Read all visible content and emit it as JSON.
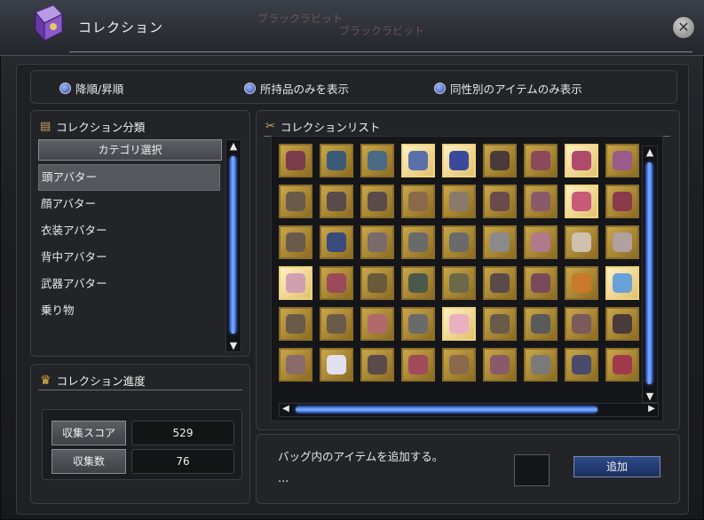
{
  "window": {
    "title": "コレクション",
    "bg_text_1": "ブラックラビット",
    "bg_text_2": "ブラックラビット"
  },
  "options": [
    {
      "label": "降順/昇順"
    },
    {
      "label": "所持品のみを表示"
    },
    {
      "label": "同性別のアイテムのみ表示"
    }
  ],
  "category_panel": {
    "heading": "コレクション分類",
    "select_button": "カテゴリ選択",
    "items": [
      {
        "label": "頭アバター",
        "selected": true
      },
      {
        "label": "顔アバター",
        "selected": false
      },
      {
        "label": "衣装アバター",
        "selected": false
      },
      {
        "label": "背中アバター",
        "selected": false
      },
      {
        "label": "武器アバター",
        "selected": false
      },
      {
        "label": "乗り物",
        "selected": false
      }
    ]
  },
  "progress_panel": {
    "heading": "コレクション進度",
    "score_label": "収集スコア",
    "score_value": "529",
    "count_label": "収集数",
    "count_value": "76"
  },
  "list_panel": {
    "heading": "コレクションリスト",
    "grid": {
      "rows": 6,
      "cols": 9,
      "highlighted": [
        3,
        4,
        7,
        16,
        27,
        35,
        40,
        55
      ],
      "icon_colors": [
        "#7a3b4a",
        "#3a5a78",
        "#4a6a86",
        "#5a70a8",
        "#3a4a9a",
        "#4a3a3a",
        "#8a4a5a",
        "#b04a6a",
        "#9a5a8a",
        "#6a5a4a",
        "#5a4a4a",
        "#5a4a4a",
        "#8a6a4a",
        "#8a7a6a",
        "#6a4a4a",
        "#8a5a6a",
        "#c85a7a",
        "#8a3a4a",
        "#6a5a4a",
        "#3a4a7a",
        "#7a6a6a",
        "#6a6a6a",
        "#6a6a6a",
        "#8a8a8a",
        "#b07a8a",
        "#d0c0b0",
        "#b0a0a0",
        "#d0a0b0",
        "#9a4a5a",
        "#6a5a3a",
        "#4a5a4a",
        "#6a6a4a",
        "#5a4a4a",
        "#7a4a5a",
        "#c87a2a",
        "#6aa0d8",
        "#6a5a4a",
        "#6a5a4a",
        "#b06a6a",
        "#6a6a6a",
        "#e8b0c0",
        "#6a5a4a",
        "#5a5a5a",
        "#7a5a5a",
        "#4a3a3a",
        "#8a6a6a",
        "#e0e0f0",
        "#5a4a4a",
        "#a04a5a",
        "#8a6a4a",
        "#8a5a6a",
        "#7a7a7a",
        "#4a4a6a",
        "#a03a4a"
      ]
    }
  },
  "add_panel": {
    "text": "バッグ内のアイテムを追加する。",
    "dots": "...",
    "add_button": "追加"
  },
  "colors": {
    "accent_blue": "#4a86ff",
    "gold_frame": "#8a6d2a"
  },
  "icons": {
    "app": "collection-book-icon",
    "close": "close-icon",
    "category": "book-icon",
    "progress": "crown-icon",
    "list": "ribbon-icon"
  }
}
